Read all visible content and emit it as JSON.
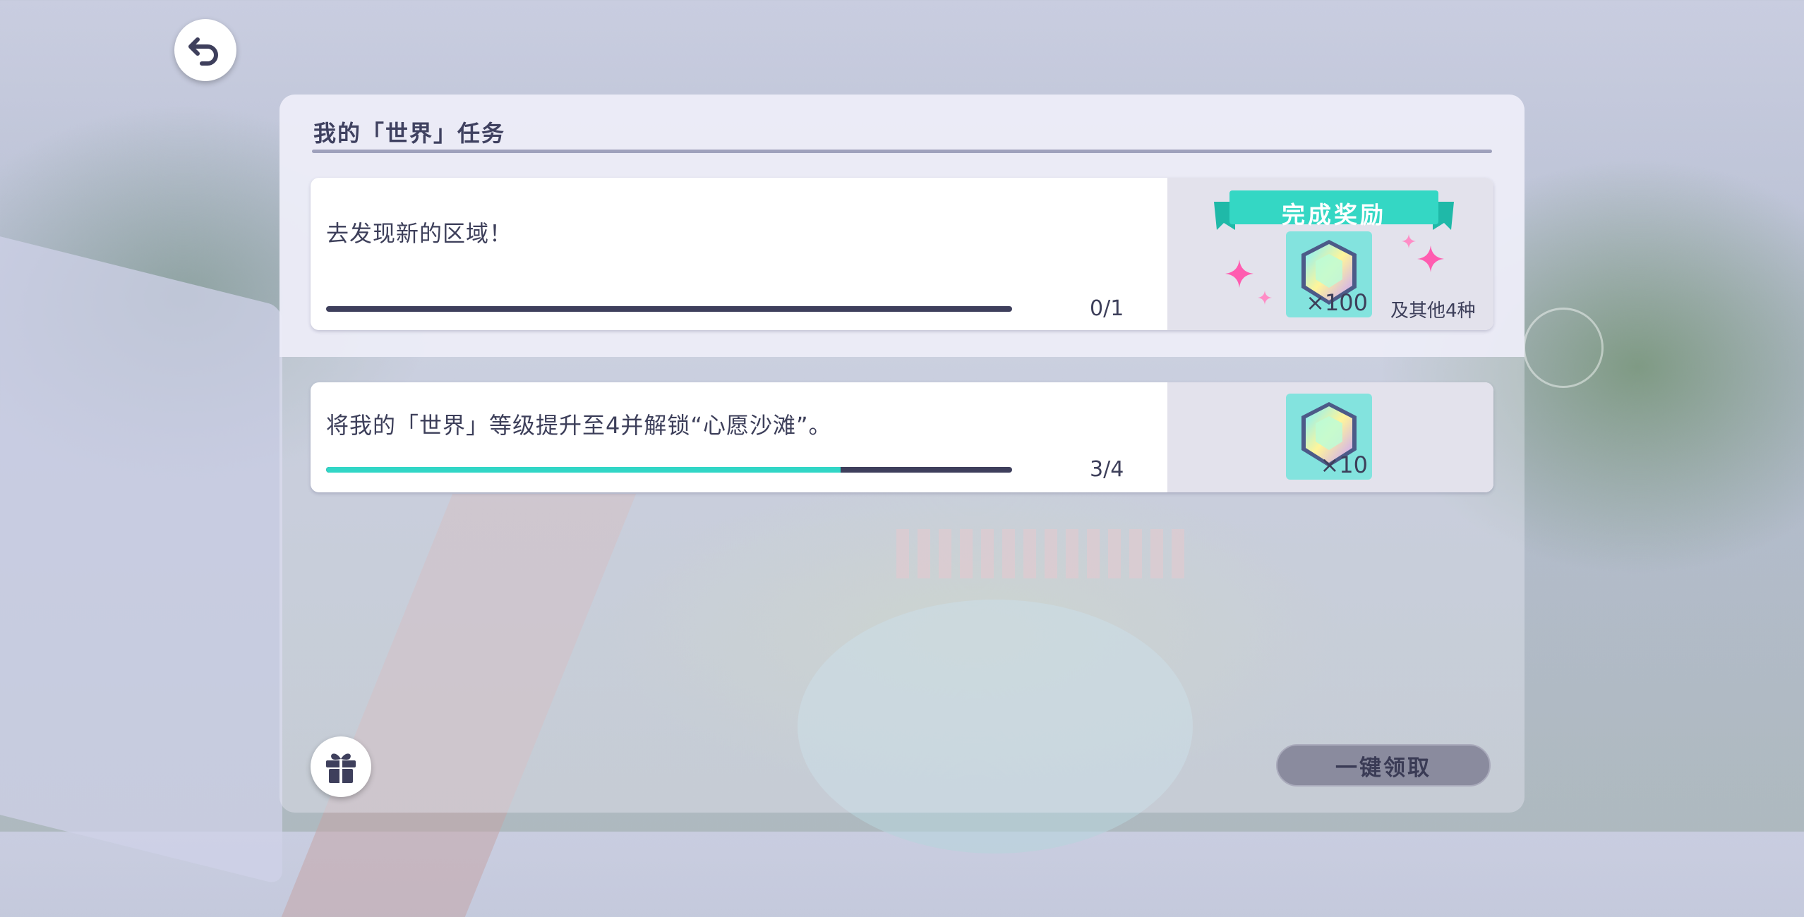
{
  "title": "我的「世界」任务",
  "tasks": [
    {
      "text": "去发现新的区域！",
      "progress": "0/1",
      "fraction": 0,
      "reward_banner": "完成奖励",
      "reward_qty": "×100",
      "reward_more": "及其他4种"
    },
    {
      "text": "将我的「世界」等级提升至4并解锁“心愿沙滩”。",
      "progress": "3/4",
      "fraction": 0.75,
      "reward_qty": "×10"
    }
  ],
  "claim_all": "一键领取",
  "icons": {
    "back": "back-arrow-icon",
    "gift": "gift-icon",
    "reward": "crystal-gem-icon"
  },
  "colors": {
    "accent": "#31d6c6",
    "bar_track": "#3e3f5c",
    "text": "#3d3f5a",
    "gem_tile": "#83e3de",
    "sparkle": "#ff5cb0"
  }
}
